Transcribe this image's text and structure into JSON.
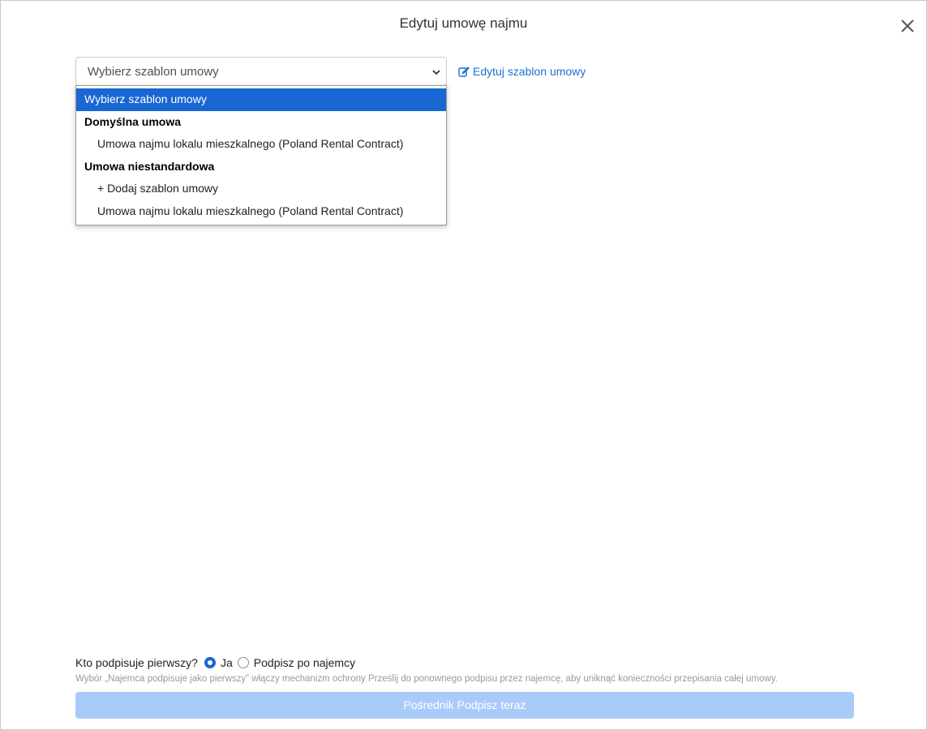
{
  "modal": {
    "title": "Edytuj umowę najmu"
  },
  "template_select": {
    "value": "Wybierz szablon umowy"
  },
  "edit_template_link": "Edytuj szablon umowy",
  "dropdown": {
    "options": [
      {
        "label": "Wybierz szablon umowy",
        "kind": "option",
        "selected": true
      },
      {
        "label": "Domyślna umowa",
        "kind": "group"
      },
      {
        "label": "Umowa najmu lokalu mieszkalnego (Poland Rental Contract)",
        "kind": "child"
      },
      {
        "label": "Umowa niestandardowa",
        "kind": "group"
      },
      {
        "label": "+ Dodaj szablon umowy",
        "kind": "child"
      },
      {
        "label": "Umowa najmu lokalu mieszkalnego (Poland Rental Contract)",
        "kind": "child"
      }
    ]
  },
  "signer": {
    "question": "Kto podpisuje pierwszy?",
    "option_yes": "Ja",
    "option_after": "Podpisz po najemcy",
    "selected": "Ja"
  },
  "hint": "Wybór „Najemca podpisuje jako pierwszy” włączy mechanizm ochrony Prześlij do ponownego podpisu przez najemcę, aby uniknąć konieczności przepisania całej umowy.",
  "sign_button": "Pośrednik Podpisz teraz",
  "colors": {
    "accent": "#1967d2",
    "link": "#1a73d1",
    "button_disabled": "#a9cbfa"
  }
}
